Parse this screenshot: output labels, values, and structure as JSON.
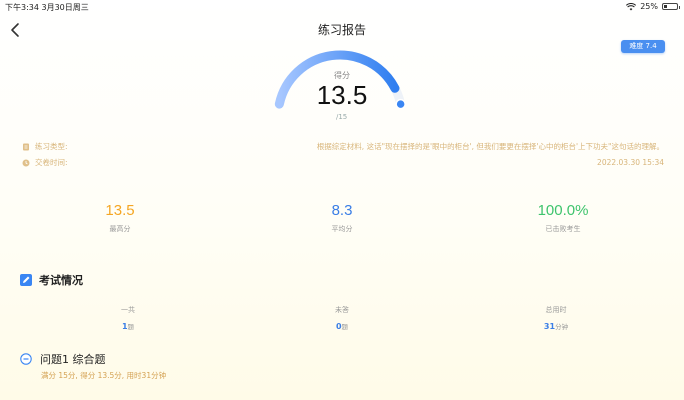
{
  "status": {
    "time": "下午3:34  3月30日周三",
    "battery": "25%",
    "battery_level": 0.25
  },
  "header": {
    "title": "练习报告",
    "difficulty": "难度 7.4"
  },
  "score": {
    "label": "得分",
    "value": "13.5",
    "total": "/15",
    "fraction": 0.9
  },
  "info": {
    "type_label": "练习类型:",
    "type_value": "根据综定材料, 这话\"现在摆择的是'眼中的柜台', 但我们要更在摆择'心中的柜台'上下功夫\"这句话的理解。",
    "time_label": "交卷时间:",
    "time_value": "2022.03.30 15:34"
  },
  "stats": [
    {
      "value": "13.5",
      "label": "最高分",
      "color": "#f5a623"
    },
    {
      "value": "8.3",
      "label": "平均分",
      "color": "#3a7ee6"
    },
    {
      "value": "100.0%",
      "label": "已击败考生",
      "color": "#3ec46d"
    }
  ],
  "exam_section": {
    "title": "考试情况",
    "items": [
      {
        "label": "一共",
        "value": "1",
        "unit": "题"
      },
      {
        "label": "未答",
        "value": "0",
        "unit": "题"
      },
      {
        "label": "总用时",
        "value": "31",
        "unit": "分钟"
      }
    ]
  },
  "question": {
    "title": "问题1  综合题",
    "summary": "满分 15分, 得分 13.5分, 用时31分钟"
  }
}
